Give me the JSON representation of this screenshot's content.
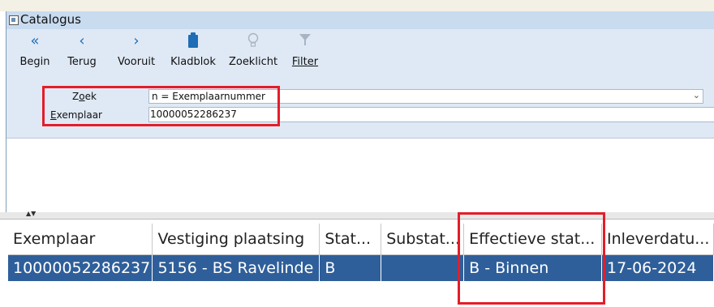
{
  "window": {
    "title": "Catalogus"
  },
  "toolbar": {
    "buttons": [
      {
        "icon": "double-left-icon",
        "glyph": "«",
        "label": "Begin"
      },
      {
        "icon": "left-icon",
        "glyph": "‹",
        "label": "Terug"
      },
      {
        "icon": "right-icon",
        "glyph": "›",
        "label": "Vooruit"
      },
      {
        "icon": "clipboard-icon",
        "glyph": "",
        "label": "Kladblok"
      },
      {
        "icon": "lightbulb-icon",
        "glyph": "♁",
        "label": "Zoeklicht"
      },
      {
        "icon": "filter-icon",
        "glyph": "▼",
        "label": "Filter"
      }
    ]
  },
  "search": {
    "zoek_label": "Zoek",
    "zoek_value": "n = Exemplaarnummer",
    "exemplaar_label": "Exemplaar",
    "exemplaar_value": "10000052286237"
  },
  "grid": {
    "columns": [
      "Exemplaar",
      "Vestiging plaatsing",
      "Stat...",
      "Substat...",
      "Effectieve stat...",
      "Inleverdatu..."
    ],
    "rows": [
      [
        "10000052286237",
        "5156 - BS Ravelinde",
        "B",
        "",
        "B - Binnen",
        "17-06-2024"
      ]
    ]
  },
  "colors": {
    "accent": "#e41d2a",
    "selection": "#2f5f9a",
    "toolbar_bg": "#dfe9f5",
    "titlebar_bg": "#c8dbef"
  }
}
